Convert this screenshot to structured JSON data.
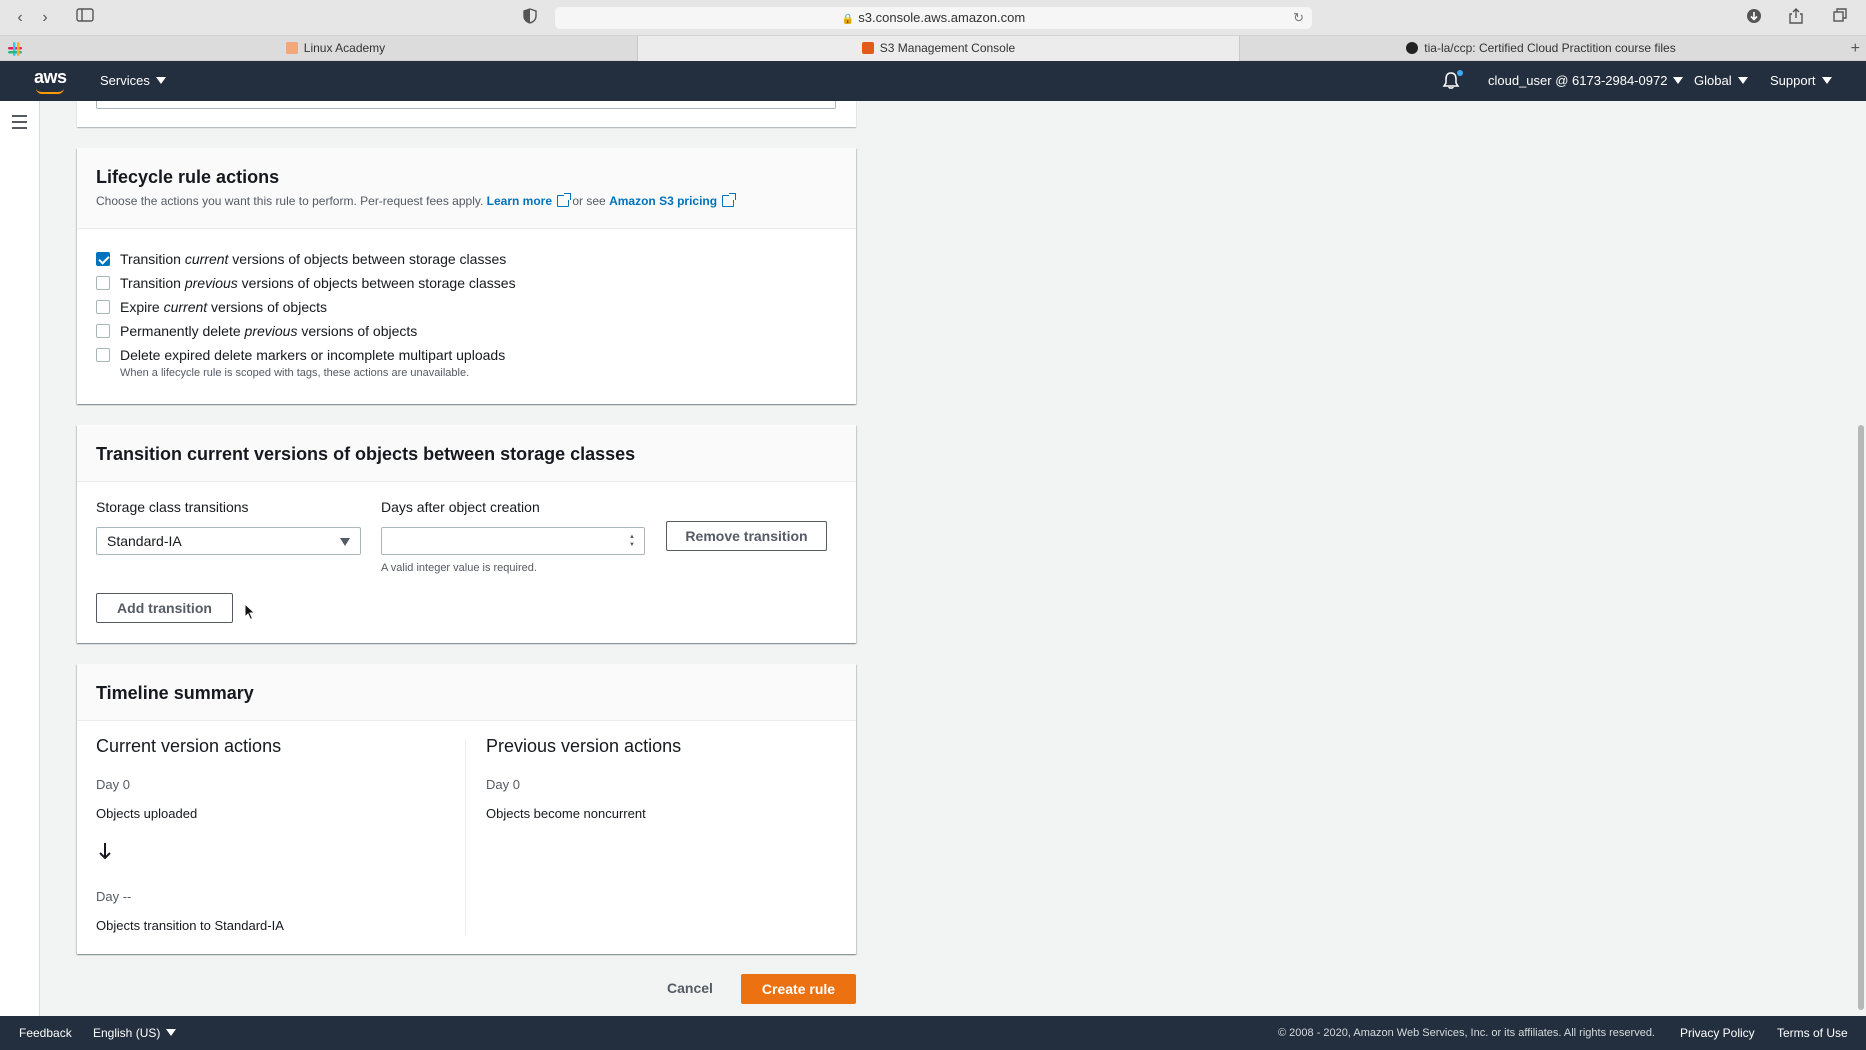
{
  "browser": {
    "url": "s3.console.aws.amazon.com",
    "tabs": [
      {
        "label": "Linux Academy"
      },
      {
        "label": "S3 Management Console"
      },
      {
        "label": "tia-la/ccp: Certified Cloud Practition course files"
      }
    ]
  },
  "nav": {
    "services_label": "Services",
    "account_label": "cloud_user @ 6173-2984-0972",
    "region_label": "Global",
    "support_label": "Support"
  },
  "lifecycle": {
    "title": "Lifecycle rule actions",
    "desc_prefix": "Choose the actions you want this rule to perform. Per-request fees apply.",
    "learn_more": "Learn more",
    "or_see": "or see",
    "pricing_link": "Amazon S3 pricing",
    "options": [
      {
        "pre": "Transition ",
        "em": "current",
        "post": " versions of objects between storage classes",
        "checked": true
      },
      {
        "pre": "Transition ",
        "em": "previous",
        "post": " versions of objects between storage classes",
        "checked": false
      },
      {
        "pre": "Expire ",
        "em": "current",
        "post": " versions of objects",
        "checked": false
      },
      {
        "pre": "Permanently delete ",
        "em": "previous",
        "post": " versions of objects",
        "checked": false
      },
      {
        "pre": "Delete expired delete markers or incomplete multipart uploads",
        "em": "",
        "post": "",
        "checked": false
      }
    ],
    "hint": "When a lifecycle rule is scoped with tags, these actions are unavailable."
  },
  "transition": {
    "title": "Transition current versions of objects between storage classes",
    "storage_label": "Storage class transitions",
    "storage_value": "Standard-IA",
    "days_label": "Days after object creation",
    "days_value": "",
    "days_help": "A valid integer value is required.",
    "remove_button": "Remove transition",
    "add_button": "Add transition"
  },
  "timeline": {
    "title": "Timeline summary",
    "current_heading": "Current version actions",
    "current_day0": "Day 0",
    "current_event0": "Objects uploaded",
    "current_day1": "Day --",
    "current_event1": "Objects transition to Standard-IA",
    "previous_heading": "Previous version actions",
    "previous_day0": "Day 0",
    "previous_event0": "Objects become noncurrent"
  },
  "actions": {
    "cancel": "Cancel",
    "create": "Create rule"
  },
  "footer": {
    "feedback": "Feedback",
    "language": "English (US)",
    "copyright": "© 2008 - 2020, Amazon Web Services, Inc. or its affiliates. All rights reserved.",
    "privacy": "Privacy Policy",
    "terms": "Terms of Use"
  },
  "colors": {
    "nav_bg": "#232f3e",
    "primary": "#ec7211",
    "link": "#0073bb",
    "checkbox_checked": "#0073bb"
  },
  "icons": [
    "back-icon",
    "forward-icon",
    "sidebar-icon",
    "shield-icon",
    "lock-icon",
    "reload-icon",
    "download-icon",
    "share-icon",
    "tabs-icon",
    "slack-icon",
    "aws-logo",
    "bell-icon",
    "hamburger-icon",
    "external-link-icon",
    "arrow-down-icon",
    "cursor-icon"
  ]
}
